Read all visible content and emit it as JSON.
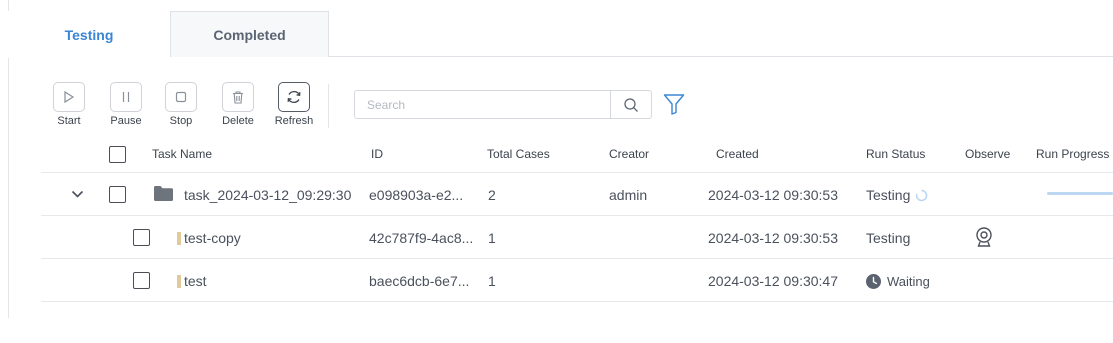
{
  "tabs": [
    {
      "label": "Testing",
      "active": true
    },
    {
      "label": "Completed",
      "active": false
    }
  ],
  "toolbar": {
    "start_label": "Start",
    "pause_label": "Pause",
    "stop_label": "Stop",
    "delete_label": "Delete",
    "refresh_label": "Refresh",
    "search_placeholder": "Search",
    "search_value": ""
  },
  "table": {
    "headers": {
      "task_name": "Task Name",
      "id": "ID",
      "total_cases": "Total Cases",
      "creator": "Creator",
      "created": "Created",
      "run_status": "Run Status",
      "observe": "Observe",
      "run_progress": "Run Progress"
    },
    "rows": [
      {
        "type": "folder",
        "expanded": true,
        "name": "task_2024-03-12_09:29:30",
        "id": "e098903a-e2...",
        "total_cases": "2",
        "creator": "admin",
        "created": "2024-03-12 09:30:53",
        "status": "Testing",
        "status_icon": "spinner-icon"
      },
      {
        "type": "case",
        "name": "test-copy",
        "id": "42c787f9-4ac8...",
        "total_cases": "1",
        "creator": "",
        "created": "2024-03-12 09:30:53",
        "status": "Testing",
        "observe_icon": "webcam-icon"
      },
      {
        "type": "case",
        "name": "test",
        "id": "baec6dcb-6e7...",
        "total_cases": "1",
        "creator": "",
        "created": "2024-03-12 09:30:47",
        "status": "Waiting",
        "status_icon": "clock-icon"
      }
    ]
  },
  "colors": {
    "accent": "#3a86d4",
    "text": "#4a515c",
    "border": "#dfe2e6",
    "leaf_marker": "#e0c99a",
    "progress": "#bcd7f1"
  }
}
